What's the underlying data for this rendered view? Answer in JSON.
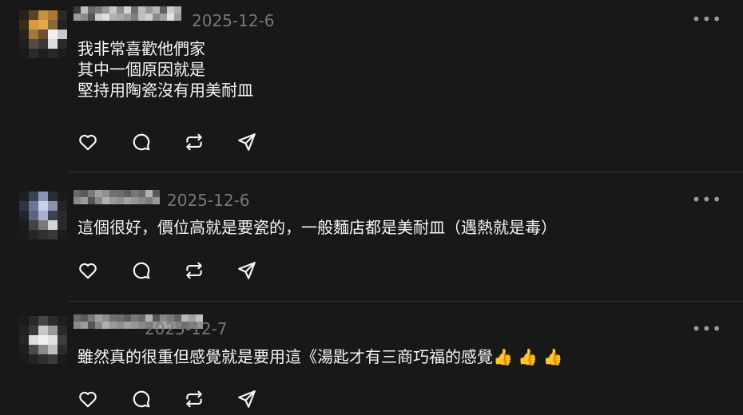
{
  "comments": [
    {
      "date": "2025-12-6",
      "text": "我非常喜歡他們家\n其中一個原因就是\n堅持用陶瓷沒有用美耐皿",
      "avatar_colors": [
        "#2a2218",
        "#5a4528",
        "#c8903a",
        "#b07830",
        "#2a2a2a",
        "#3a2c1c",
        "#d89a40",
        "#e0a848",
        "#8a6a3a",
        "#222222",
        "#2c241c",
        "#a07838",
        "#6a5030",
        "#f0f0f0",
        "#c8c8c8",
        "#1e1e1e",
        "#5a4a3a",
        "#3a3a3a",
        "#dcdcdc",
        "#2a2a2a",
        "#1a1a1a",
        "#2a2a2a",
        "#1e1e1e",
        "#282828",
        "#1c1c1c"
      ],
      "name_colors": [
        "#3a3a3a",
        "#9a9a9a",
        "#bdbdbd",
        "#8a8a8a",
        "#6a6a6a",
        "#555555",
        "#7a7a7a",
        "#cfcfcf",
        "#9a9a9a",
        "#e0e0e0",
        "#c8c8c8",
        "#b0b0b0",
        "#8f8f8f",
        "#a8a8a8",
        "#d2d2d2",
        "#9a9a9a",
        "#707070",
        "#7f7f7f",
        "#bebebe",
        "#c0c0c0",
        "#999999",
        "#d0d0d0",
        "#b5b5b5",
        "#8a8a8a",
        "#606060",
        "#a0a0a0",
        "#cccccc",
        "#e2e2e2",
        "#b0b0b0",
        "#9f9f9f"
      ]
    },
    {
      "date": "2025-12-6",
      "text": "這個很好，價位高就是要瓷的，一般麵店都是美耐皿（遇熱就是毒）",
      "avatar_colors": [
        "#1e2028",
        "#3a4258",
        "#8a96b8",
        "#2a2e38",
        "#1c1c1c",
        "#2e3444",
        "#6a7898",
        "#c8d0e8",
        "#8a94ac",
        "#242424",
        "#22252e",
        "#5a6680",
        "#a8b2cc",
        "#3c4254",
        "#2a2a2a",
        "#1c1c1c",
        "#444444",
        "#7a7a7a",
        "#d6d6d6",
        "#2a2a2a",
        "#1a1a1a",
        "#262626",
        "#303030",
        "#3a3a3a",
        "#1c1c1c"
      ],
      "name_colors": [
        "#6a6a6a",
        "#8a8a8a",
        "#5a5a5a",
        "#9c9c9c",
        "#7a7a7a",
        "#555555",
        "#a0a0a0",
        "#888888",
        "#909090",
        "#b0b0b0",
        "#707070",
        "#9a9a9a",
        "#6c6c6c",
        "#8f8f8f",
        "#5e5e5e",
        "#a2a2a2",
        "#787878",
        "#969696",
        "#6a6a6a",
        "#8a8a8a",
        "#b2b2b2",
        "#7d7d7d",
        "#595959",
        "#999999"
      ]
    },
    {
      "date": "2025-12-7",
      "text": "雖然真的很重但感覺就是要用這《湯匙才有三商巧福的感覺👍 👍 👍",
      "avatar_colors": [
        "#1c1c1c",
        "#2a2a2a",
        "#454545",
        "#2c2c2c",
        "#1e1e1e",
        "#222222",
        "#3a3a3a",
        "#c8c8c8",
        "#9a9a9a",
        "#2a2a2a",
        "#262626",
        "#dcdcdc",
        "#f0f0f0",
        "#e0e0e0",
        "#3c3c3c",
        "#1e1e1e",
        "#4a4a4a",
        "#8a8a8a",
        "#c0c0c0",
        "#2c2c2c",
        "#1a1a1a",
        "#242424",
        "#303030",
        "#3c3c3c",
        "#1c1c1c"
      ],
      "name_colors": [
        "#6a6a6a",
        "#8a8a8a",
        "#5a5a5a",
        "#9c9c9c",
        "#7a7a7a",
        "#555555",
        "#a0a0a0",
        "#888888",
        "#909090",
        "#b0b0b0",
        "#707070",
        "#9a9a9a",
        "#6c6c6c",
        "#8f8f8f",
        "#5e5e5e",
        "#a2a2a2",
        "#787878",
        "#969696",
        "#6a6a6a",
        "#8a8a8a",
        "#b2b2b2",
        "#7d7d7d",
        "#595959",
        "#999999",
        "#888888",
        "#a5a5a5",
        "#777777",
        "#9e9e9e",
        "#636363",
        "#8b8b8b",
        "#b5b5b5",
        "#707070",
        "#a0a0a0",
        "#808080",
        "#c0c0c0",
        "#959595"
      ]
    }
  ],
  "actions": [
    "heart-icon",
    "comment-icon",
    "repost-icon",
    "share-icon"
  ]
}
